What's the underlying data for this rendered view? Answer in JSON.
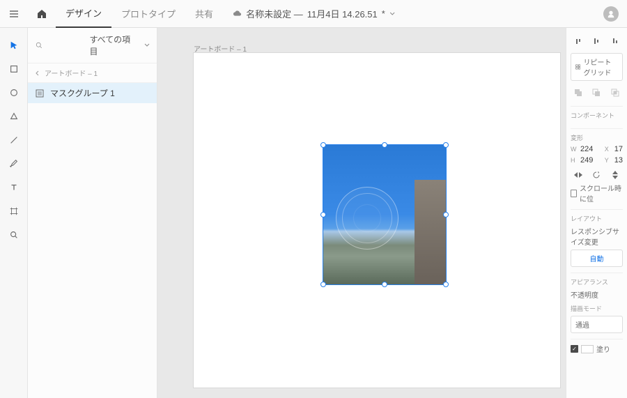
{
  "topbar": {
    "tabs": {
      "design": "デザイン",
      "prototype": "プロトタイプ",
      "share": "共有"
    },
    "title_prefix": "名称未設定 —",
    "title_date": "11月4日 14.26.51",
    "title_suffix": "*"
  },
  "layers": {
    "search_label": "すべての項目",
    "breadcrumb": "アートボード – 1",
    "item": "マスクグループ 1"
  },
  "canvas": {
    "artboard_label": "アートボード – 1"
  },
  "inspector": {
    "repeat_grid": "リピートグリッド",
    "sec_component": "コンポーネント",
    "sec_transform": "変形",
    "w_label": "W",
    "w_value": "224",
    "x_label": "X",
    "x_value": "17",
    "h_label": "H",
    "h_value": "249",
    "y_label": "Y",
    "y_value": "13",
    "scroll_fix": "スクロール時に位",
    "sec_layout": "レイアウト",
    "responsive": "レスポンシブサイズ変更",
    "responsive_btn": "自動",
    "sec_appearance": "アピアランス",
    "opacity": "不透明度",
    "blend_mode": "描画モード",
    "blend_value": "通過",
    "fill": "塗り"
  },
  "tools": [
    "select",
    "rectangle",
    "ellipse",
    "polygon",
    "line",
    "pen",
    "text",
    "artboard",
    "zoom"
  ]
}
